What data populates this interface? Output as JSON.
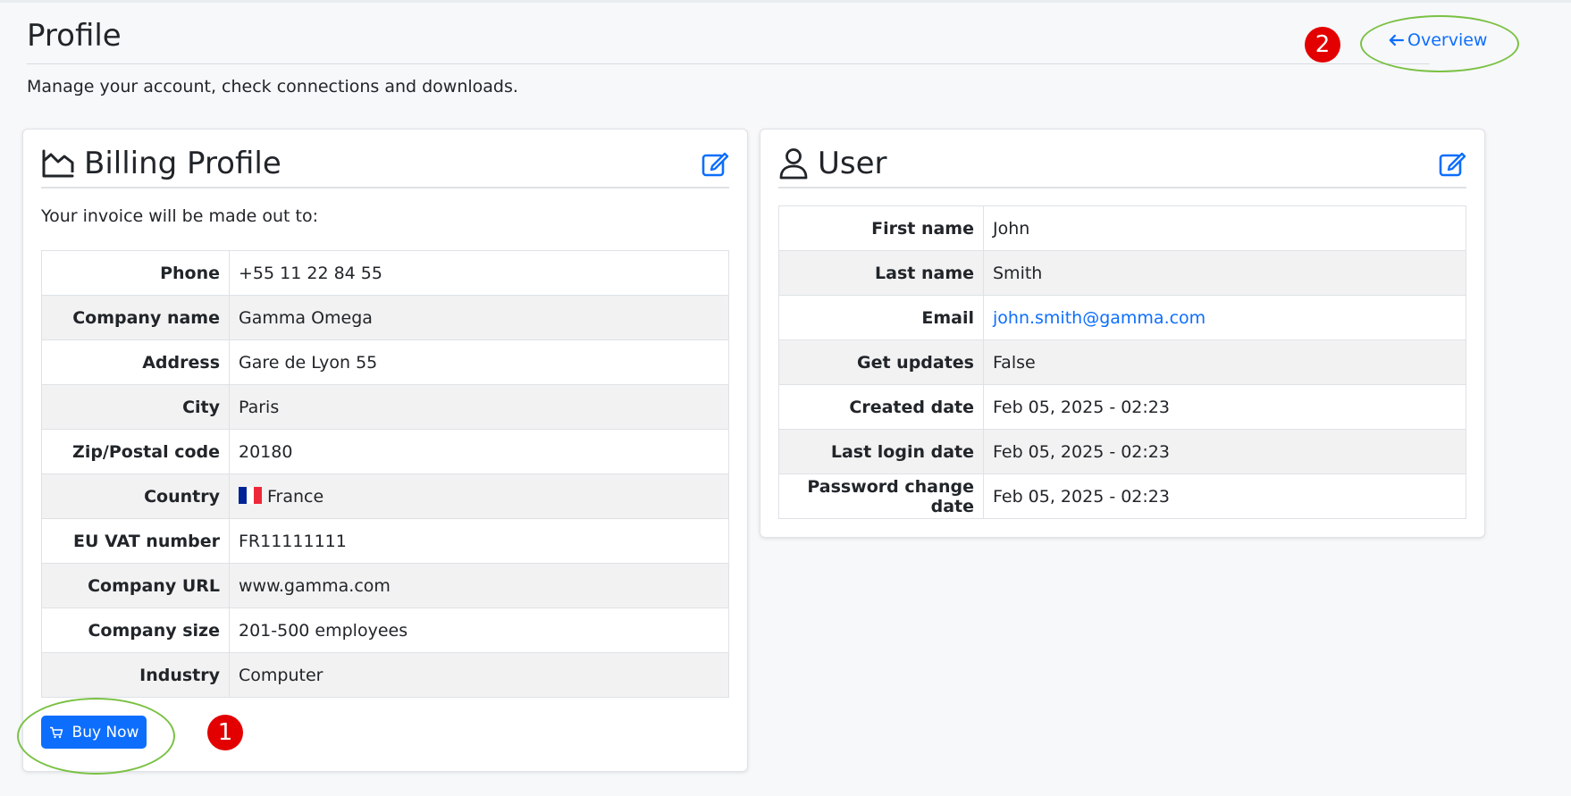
{
  "page": {
    "title": "Profile",
    "subtitle": "Manage your account, check connections and downloads.",
    "overview_link": "Overview"
  },
  "markers": {
    "one": "1",
    "two": "2"
  },
  "billing": {
    "title": "Billing Profile",
    "intro": "Your invoice will be made out to:",
    "rows": [
      {
        "label": "Phone",
        "value": "+55 11 22 84 55"
      },
      {
        "label": "Company name",
        "value": "Gamma Omega"
      },
      {
        "label": "Address",
        "value": "Gare de Lyon 55"
      },
      {
        "label": "City",
        "value": "Paris"
      },
      {
        "label": "Zip/Postal code",
        "value": "20180"
      },
      {
        "label": "Country",
        "value": "France"
      },
      {
        "label": "EU VAT number",
        "value": "FR11111111"
      },
      {
        "label": "Company URL",
        "value": "www.gamma.com"
      },
      {
        "label": "Company size",
        "value": "201-500 employees"
      },
      {
        "label": "Industry",
        "value": "Computer"
      }
    ],
    "buy_label": "Buy Now"
  },
  "user": {
    "title": "User",
    "rows": [
      {
        "label": "First name",
        "value": "John"
      },
      {
        "label": "Last name",
        "value": "Smith"
      },
      {
        "label": "Email",
        "value": "john.smith@gamma.com"
      },
      {
        "label": "Get updates",
        "value": "False"
      },
      {
        "label": "Created date",
        "value": "Feb 05, 2025 - 02:23"
      },
      {
        "label": "Last login date",
        "value": "Feb 05, 2025 - 02:23"
      },
      {
        "label": "Password change date",
        "value": "Feb 05, 2025 - 02:23"
      }
    ]
  },
  "icons": {
    "back": "arrow-left-icon",
    "billing": "chart-area-icon",
    "user": "person-icon",
    "edit": "pencil-square-icon",
    "cart": "cart-icon",
    "flag": "france-flag-icon"
  },
  "colors": {
    "accent": "#0d6efd",
    "marker": "#e30000",
    "highlight": "#7ac143",
    "flag_blue": "#002395",
    "flag_white": "#ffffff",
    "flag_red": "#ed2939"
  }
}
